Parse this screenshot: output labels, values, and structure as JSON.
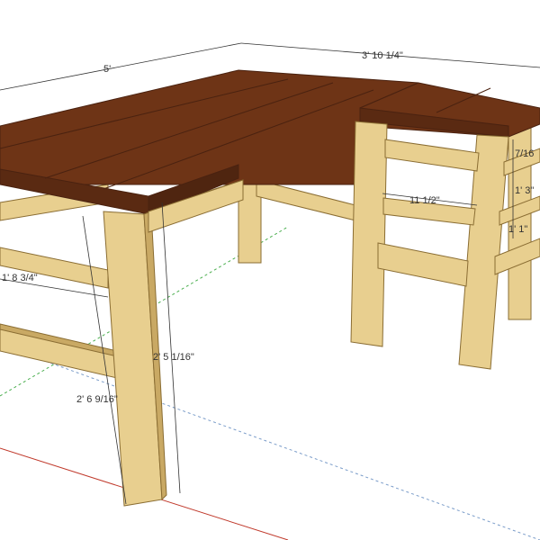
{
  "colors": {
    "background": "#ffffff",
    "top_wood": "#6e3416",
    "top_wood_edge": "#5a2a12",
    "frame_wood": "#e8cf8f",
    "frame_wood_dark": "#c9a964",
    "ground_blue_axis": "#7a9cc9",
    "ground_green_axis": "#4caf50",
    "ground_red_axis": "#c0392b",
    "dimension_line": "#333333"
  },
  "dimensions": {
    "top_length": "5'",
    "return_length": "3' 10 1/4\"",
    "return_width": "11 1/2\"",
    "shelf_height_top": "7/16",
    "shelf_gap_1": "1' 3\"",
    "shelf_gap_2": "1' 1\"",
    "apron_depth": "1' 8 3/4\"",
    "leg_height": "2' 5 1/16\"",
    "overall_height": "2' 6 9/16\""
  }
}
